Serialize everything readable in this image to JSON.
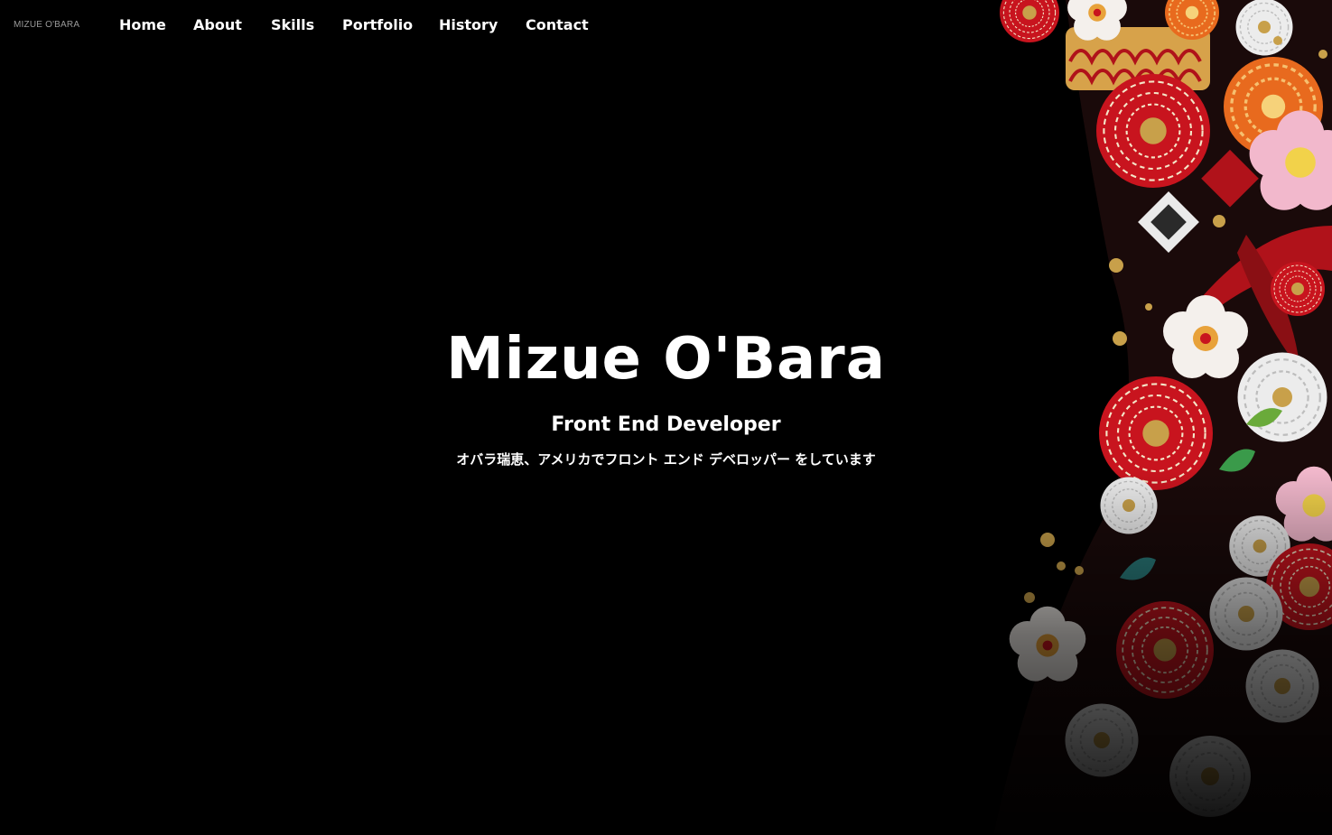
{
  "nav": {
    "brand": "MIZUE O'BARA",
    "links": [
      "Home",
      "About",
      "Skills",
      "Portfolio",
      "History",
      "Contact"
    ]
  },
  "hero": {
    "title": "Mizue O'Bara",
    "subtitle": "Front End Developer",
    "japanese": "オバラ瑞恵、アメリカでフロント エンド デベロッパー をしています"
  },
  "colors": {
    "background": "#000000",
    "text": "#ffffff",
    "brand_text": "#9a9a9a",
    "floral_red": "#c8141e",
    "floral_gold": "#c8a04a",
    "floral_pink": "#f2b8cc",
    "floral_white": "#f4f0ec"
  },
  "icons": {
    "background_art": "japanese-floral-pattern"
  }
}
